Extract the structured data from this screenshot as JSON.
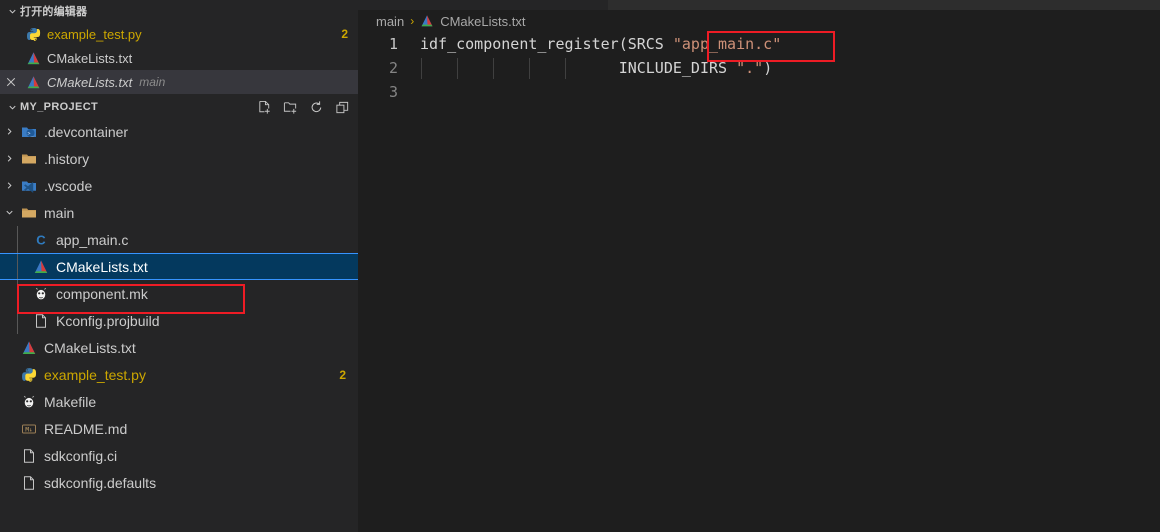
{
  "colors": {
    "sidebar_bg": "#252526",
    "editor_bg": "#1e1e1e",
    "selection_bg": "#04395e",
    "selection_border": "#3794ff",
    "annotation_red": "#ee1c25",
    "warning_badge": "#cca700",
    "string_token": "#ce9178",
    "text": "#cccccc"
  },
  "sidebar": {
    "open_editors": {
      "title": "打开的编辑器",
      "twisty_icon": "chevron-down-icon",
      "items": [
        {
          "label": "example_test.py",
          "icon": "python-file-icon",
          "badge": "2",
          "active": false,
          "italic": false,
          "description": "",
          "name_class": "name-yellow"
        },
        {
          "label": "CMakeLists.txt",
          "icon": "cmake-file-icon",
          "badge": "",
          "active": false,
          "italic": false,
          "description": "",
          "name_class": ""
        },
        {
          "label": "CMakeLists.txt",
          "icon": "cmake-file-icon",
          "badge": "",
          "active": true,
          "italic": true,
          "description": "main",
          "name_class": ""
        }
      ],
      "close_icon": "close-icon"
    },
    "explorer": {
      "title": "MY_PROJECT",
      "twisty_icon": "chevron-down-icon",
      "actions": [
        {
          "name": "new-file-icon",
          "tooltip": "New File"
        },
        {
          "name": "new-folder-icon",
          "tooltip": "New Folder"
        },
        {
          "name": "refresh-icon",
          "tooltip": "Refresh Explorer"
        },
        {
          "name": "collapse-all-icon",
          "tooltip": "Collapse Folders in Explorer"
        }
      ],
      "tree": [
        {
          "label": ".devcontainer",
          "icon": "folder-devcontainer-icon",
          "type": "folder",
          "expanded": false,
          "depth": 0,
          "selected": false,
          "badge": ""
        },
        {
          "label": ".history",
          "icon": "folder-icon",
          "type": "folder",
          "expanded": false,
          "depth": 0,
          "selected": false,
          "badge": ""
        },
        {
          "label": ".vscode",
          "icon": "folder-vscode-icon",
          "type": "folder",
          "expanded": false,
          "depth": 0,
          "selected": false,
          "badge": ""
        },
        {
          "label": "main",
          "icon": "folder-open-icon",
          "type": "folder",
          "expanded": true,
          "depth": 0,
          "selected": false,
          "badge": ""
        },
        {
          "label": "app_main.c",
          "icon": "c-file-icon",
          "type": "file",
          "expanded": false,
          "depth": 1,
          "selected": false,
          "badge": ""
        },
        {
          "label": "CMakeLists.txt",
          "icon": "cmake-file-icon",
          "type": "file",
          "expanded": false,
          "depth": 1,
          "selected": true,
          "badge": ""
        },
        {
          "label": "component.mk",
          "icon": "gnu-make-file-icon",
          "type": "file",
          "expanded": false,
          "depth": 1,
          "selected": false,
          "badge": ""
        },
        {
          "label": "Kconfig.projbuild",
          "icon": "plain-file-icon",
          "type": "file",
          "expanded": false,
          "depth": 1,
          "selected": false,
          "badge": ""
        },
        {
          "label": "CMakeLists.txt",
          "icon": "cmake-file-icon",
          "type": "file",
          "expanded": false,
          "depth": 0,
          "selected": false,
          "badge": ""
        },
        {
          "label": "example_test.py",
          "icon": "python-file-icon",
          "type": "file",
          "expanded": false,
          "depth": 0,
          "selected": false,
          "badge": "2"
        },
        {
          "label": "Makefile",
          "icon": "gnu-make-file-icon",
          "type": "file",
          "expanded": false,
          "depth": 0,
          "selected": false,
          "badge": ""
        },
        {
          "label": "README.md",
          "icon": "markdown-file-icon",
          "type": "file",
          "expanded": false,
          "depth": 0,
          "selected": false,
          "badge": ""
        },
        {
          "label": "sdkconfig.ci",
          "icon": "plain-file-icon",
          "type": "file",
          "expanded": false,
          "depth": 0,
          "selected": false,
          "badge": ""
        },
        {
          "label": "sdkconfig.defaults",
          "icon": "plain-file-icon",
          "type": "file",
          "expanded": false,
          "depth": 0,
          "selected": false,
          "badge": ""
        }
      ]
    }
  },
  "editor": {
    "breadcrumb": {
      "folder": "main",
      "separator": "›",
      "file": "CMakeLists.txt",
      "file_icon": "cmake-file-icon"
    },
    "lines": [
      {
        "number": "1",
        "active": true,
        "text_plain": "idf_component_register(SRCS \"app_main.c\""
      },
      {
        "number": "2",
        "active": false,
        "text_plain": "                      INCLUDE_DIRS \".\")"
      },
      {
        "number": "3",
        "active": false,
        "text_plain": ""
      }
    ],
    "line1": {
      "fn": "idf_component_register",
      "open_paren": "(",
      "arg": "SRCS",
      "space": " ",
      "string": "\"app_main.c\""
    },
    "line2": {
      "indent": "                      ",
      "keyword": "INCLUDE_DIRS",
      "space": " ",
      "string": "\".\"",
      "close_paren": ")"
    }
  },
  "annotations": [
    {
      "name": "annotation-box-sidebar-cmakelists",
      "target": "CMakeLists.txt (main)"
    },
    {
      "name": "annotation-box-code-app-main-c",
      "target": "\"app_main.c\""
    }
  ]
}
